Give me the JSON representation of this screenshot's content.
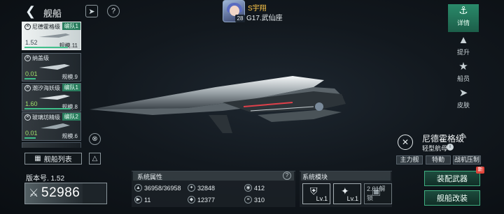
{
  "header": {
    "title": "舰船",
    "player_name": "S宇翔",
    "player_level": "28",
    "player_server": "G17.武仙座"
  },
  "ship_list": [
    {
      "name": "尼德霍格级",
      "fleet": "编队1",
      "value": "1.52",
      "scale": "规模.11",
      "selected": true,
      "bar": 0.8
    },
    {
      "name": "纳盖级",
      "fleet": "",
      "value": "0.01",
      "scale": "规模.9",
      "selected": false,
      "bar": 0.2
    },
    {
      "name": "潮汐海妖级",
      "fleet": "编队1",
      "value": "1.60",
      "scale": "规模.8",
      "selected": false,
      "bar": 0.85
    },
    {
      "name": "玻璃坊精级",
      "fleet": "编队2",
      "value": "0.01",
      "scale": "规模.6",
      "selected": false,
      "bar": 0.2
    }
  ],
  "fleet_list_label": "舰船列表",
  "version": "版本号. 1.52",
  "power": "52986",
  "attributes": {
    "title": "系统属性",
    "items": [
      {
        "icon": "hull-icon",
        "value": "36958/36958"
      },
      {
        "icon": "attack-icon",
        "value": "32848"
      },
      {
        "icon": "shield-icon",
        "value": "412"
      },
      {
        "icon": "speed-icon",
        "value": "11"
      },
      {
        "icon": "energy-icon",
        "value": "12377"
      },
      {
        "icon": "armor-icon",
        "value": "310"
      }
    ]
  },
  "modules": {
    "title": "系统模块",
    "slots": [
      {
        "icon": "shield-module-icon",
        "level": "Lv.1"
      },
      {
        "icon": "wing-module-icon",
        "level": "Lv.1"
      },
      {
        "icon": "lock-icon",
        "level": "2.01解锁"
      }
    ]
  },
  "side_nav": [
    {
      "icon": "details-icon",
      "label": "详情",
      "active": true
    },
    {
      "icon": "upgrade-icon",
      "label": "提升",
      "active": false
    },
    {
      "icon": "crew-icon",
      "label": "船员",
      "active": false
    },
    {
      "icon": "skin-icon",
      "label": "皮肤",
      "active": false
    }
  ],
  "ship_info": {
    "name": "尼德霍格级",
    "type": "轻型航母",
    "tags": [
      "主力舰",
      "特勤",
      "战机压制"
    ]
  },
  "buttons": {
    "equip": "装配武器",
    "modify": "舰船改装",
    "new_badge": "新"
  },
  "colors": {
    "accent_green": "#2a8a6a",
    "player_name": "#ffc94a",
    "power_value": "#ffffff"
  }
}
